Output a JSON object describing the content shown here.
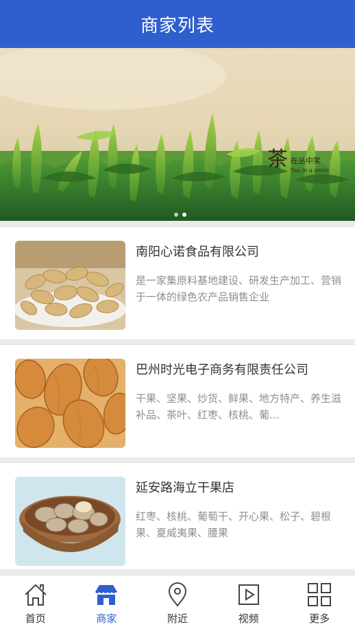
{
  "header": {
    "title": "商家列表"
  },
  "banner": {
    "logo_char": "茶",
    "logo_text": "在丛中笑",
    "logo_en": "Tea in a smile"
  },
  "merchants": [
    {
      "name": "南阳心诺食品有限公司",
      "description": "是一家集原料基地建设、研发生产加工、营销于一体的绿色农产品销售企业"
    },
    {
      "name": "巴州时光电子商务有限责任公司",
      "description": "干果、坚果、炒货、鲜果、地方特产、养生滋补品、茶叶、红枣、核桃、葡..."
    },
    {
      "name": "延安路海立干果店",
      "description": "红枣、核桃、葡萄干、开心果、松子、碧根果、夏威夷果、腰果"
    }
  ],
  "tabbar": {
    "items": [
      {
        "label": "首页",
        "icon": "home-icon"
      },
      {
        "label": "商家",
        "icon": "store-icon"
      },
      {
        "label": "附近",
        "icon": "location-pin-icon"
      },
      {
        "label": "视频",
        "icon": "video-play-icon"
      },
      {
        "label": "更多",
        "icon": "grid-icon"
      }
    ],
    "active_index": 1,
    "active_color": "#2f5fcf",
    "inactive_color": "#444444"
  },
  "colors": {
    "header_bg": "#2f5fcf"
  }
}
